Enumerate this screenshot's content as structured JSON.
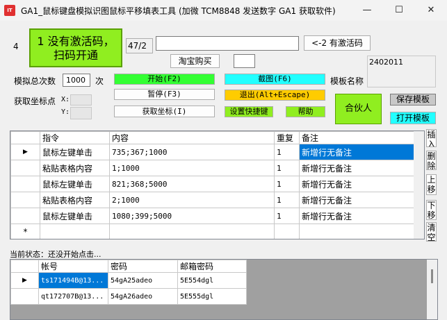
{
  "window": {
    "icon_text": "IT",
    "title": "GA1_鼠标键盘模拟识图鼠标平移填表工具 (加微 TCM8848 发送数字 GA1 获取软件)",
    "minimize": "—",
    "maximize": "☐",
    "close": "✕"
  },
  "top": {
    "num_left": "4",
    "activation_banner": "1 没有激活码，\n扫码开通",
    "page_indicator": "47/2",
    "activation_input": "",
    "activate_button": "<-2 有激活码",
    "taobao_button": "淘宝购买",
    "small_box": "",
    "code_display": "2402011"
  },
  "controls": {
    "total_label": "模拟总次数",
    "total_value": "1000",
    "times_unit": "次",
    "coord_label": "获取坐标点",
    "x_label": "X:",
    "y_label": "Y:",
    "x_value": "",
    "y_value": "",
    "start_button": "开始(F2)",
    "pause_button": "暂停(F3)",
    "getcoord_button": "获取坐标(I)",
    "screenshot_button": "截图(F6)",
    "exit_button": "退出(Alt+Escape)",
    "shortcut_button": "设置快捷键",
    "help_button": "帮助",
    "template_label": "模板名称",
    "template_name": "",
    "partner_button": "合伙人",
    "save_template": "保存模板",
    "open_template": "打开模板"
  },
  "colors": {
    "green": "#33ff33",
    "light_green": "#90ee20",
    "cyan": "#22ffff",
    "orange": "#ffcc00",
    "select_blue": "#0078d7"
  },
  "grid1": {
    "columns": [
      "指令",
      "内容",
      "重复",
      "备注"
    ],
    "rows": [
      {
        "cmd": "鼠标左键单击",
        "content": "735;367;1000",
        "repeat": "1",
        "note": "新增行无备注"
      },
      {
        "cmd": "粘贴表格内容",
        "content": "1;1000",
        "repeat": "1",
        "note": "新增行无备注"
      },
      {
        "cmd": "鼠标左键单击",
        "content": "821;368;5000",
        "repeat": "1",
        "note": "新增行无备注"
      },
      {
        "cmd": "粘贴表格内容",
        "content": "2;1000",
        "repeat": "1",
        "note": "新增行无备注"
      },
      {
        "cmd": "鼠标左键单击",
        "content": "1080;399;5000",
        "repeat": "1",
        "note": "新增行无备注"
      }
    ],
    "new_row_marker": "*",
    "current_marker": "▶"
  },
  "side": {
    "insert": "插入",
    "delete": "删除",
    "up": "上移",
    "down": "下移",
    "clear": "清空"
  },
  "status": {
    "text": "当前状态：还没开始点击..."
  },
  "grid2": {
    "columns": [
      "帐号",
      "密码",
      "邮箱密码"
    ],
    "rows": [
      {
        "account": "ts171494B@13...",
        "password": "54gA25adeo",
        "mail_password": "5E554dgl"
      },
      {
        "account": "qt172707B@13...",
        "password": "54gA26adeo",
        "mail_password": "5E555dgl"
      }
    ],
    "current_marker": "▶"
  }
}
